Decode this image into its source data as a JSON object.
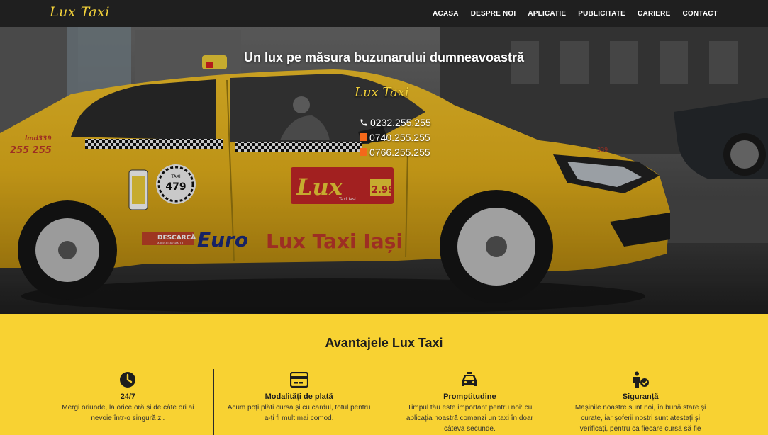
{
  "header": {
    "logo": "Lux Taxi",
    "nav": [
      "ACASA",
      "DESPRE NOI",
      "APLICATIE",
      "PUBLICITATE",
      "CARIERE",
      "CONTACT"
    ]
  },
  "hero": {
    "title": "Un lux pe măsura buzunarului dumneavoastră",
    "logo": "Lux Taxi",
    "phones": [
      {
        "icon": "phone-icon",
        "number": "0232.255.255"
      },
      {
        "icon": "orange-operator-icon",
        "number": "0740.255.255"
      },
      {
        "icon": "orange-operator-icon",
        "number": "0766.255.255"
      }
    ],
    "car_text": {
      "roof_sign": "lmd339",
      "door_number": "255 255",
      "badge_label": "TAXI",
      "badge_number": "479",
      "ad_brand": "Lux",
      "ad_sub": "Taxi Iasi",
      "ad_price": "2.99",
      "download_label": "DESCARCĂ",
      "download_sub": "APLICATIA GRATUIT",
      "brand_euro": "Euro",
      "brand_rest": "Lux Taxi Iași",
      "plate": "339"
    },
    "accent": "#f2d13a",
    "orange": "#f4681a"
  },
  "advantages": {
    "title": "Avantajele Lux Taxi",
    "items": [
      {
        "icon": "clock-icon",
        "title": "24/7",
        "text": "Mergi oriunde, la orice oră și de câte ori ai nevoie într-o singură zi."
      },
      {
        "icon": "credit-card-icon",
        "title": "Modalități de plată",
        "text": "Acum poți plăti cursa și cu cardul, totul pentru a-ți fi mult mai comod."
      },
      {
        "icon": "taxi-icon",
        "title": "Promptitudine",
        "text": "Timpul tău este important pentru noi: cu aplicația noastră comanzi un taxi în doar câteva secunde."
      },
      {
        "icon": "verified-person-icon",
        "title": "Siguranță",
        "text": "Mașinile noastre sunt noi, în bună stare și curate, iar șoferii noștri sunt atestați și verificați, pentru ca fiecare cursă să fie"
      }
    ],
    "background": "#f8d232"
  }
}
